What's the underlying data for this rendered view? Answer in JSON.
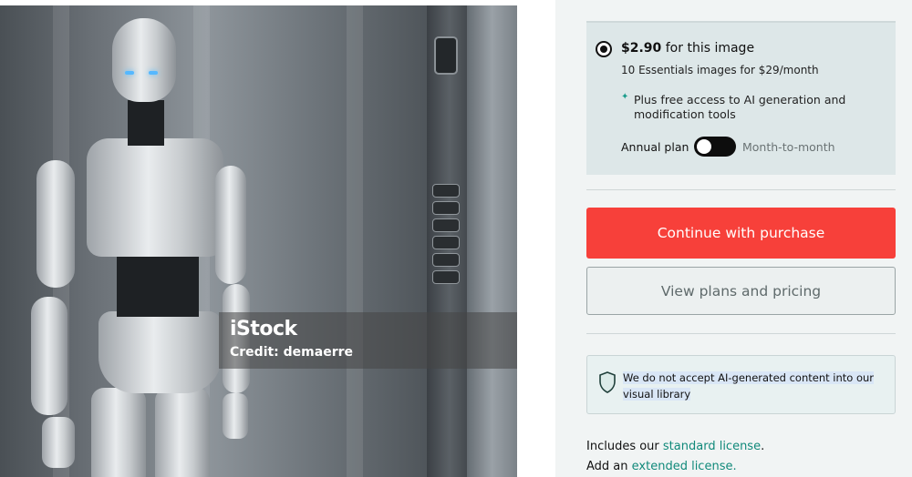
{
  "image": {
    "watermark_logo": "iStock",
    "watermark_credit": "Credit: demaerre"
  },
  "plan": {
    "price": "$2.90",
    "price_suffix": "for this image",
    "subscription": "10 Essentials images for $29/month",
    "ai_note": "Plus free access to AI generation and modification tools",
    "annual_label": "Annual plan",
    "toggle_state": "annual",
    "month_label": "Month-to-month"
  },
  "actions": {
    "purchase_label": "Continue with purchase",
    "plans_label": "View plans and pricing"
  },
  "notice": {
    "text": "We do not accept AI-generated content into our visual library"
  },
  "license": {
    "prefix1": "Includes our",
    "standard_link": "standard license",
    "suffix1": ".",
    "prefix2": "Add an",
    "extended_link": "extended license."
  },
  "colors": {
    "primary": "#f7403a",
    "link": "#10897a",
    "card_bg": "#dde7e8"
  }
}
